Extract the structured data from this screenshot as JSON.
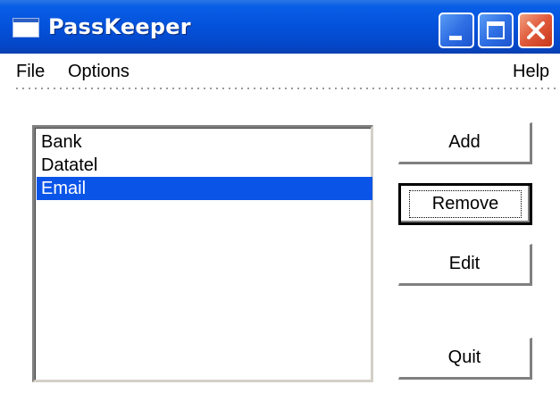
{
  "window": {
    "title": "PassKeeper",
    "accent_color": "#0453dc",
    "close_color": "#e0583a"
  },
  "menu": {
    "file": "File",
    "options": "Options",
    "help": "Help"
  },
  "list": {
    "items": [
      "Bank",
      "Datatel",
      "Email"
    ],
    "selected": "Email",
    "selection_color": "#0a55e8"
  },
  "buttons": {
    "add": "Add",
    "remove": "Remove",
    "edit": "Edit",
    "quit": "Quit"
  },
  "icons": {
    "app": "window-icon",
    "minimize": "minimize-icon",
    "maximize": "maximize-icon",
    "close": "close-icon"
  }
}
